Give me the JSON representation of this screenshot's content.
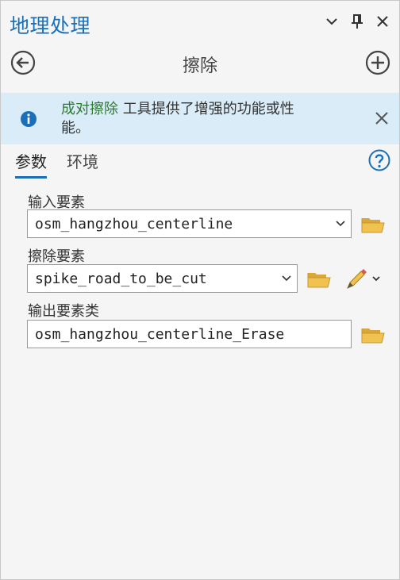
{
  "pane": {
    "title": "地理处理",
    "icons": {
      "dropdown": "chevron-down-icon",
      "pin": "pin-icon",
      "close": "close-icon"
    }
  },
  "nav": {
    "title": "擦除",
    "back_icon": "back-arrow-icon",
    "add_icon": "add-circle-icon"
  },
  "banner": {
    "link_text": "成对擦除",
    "message_line1": " 工具提供了增强的功能或性",
    "message_line2": "能。",
    "info_icon": "info-icon",
    "close_icon": "close-icon",
    "background": "#d9ecf8"
  },
  "tabs": [
    {
      "label": "参数",
      "active": true
    },
    {
      "label": "环境",
      "active": false
    }
  ],
  "help_icon": "help-icon",
  "parameters": [
    {
      "label": "输入要素",
      "value": "osm_hangzhou_centerline",
      "type": "dropdown"
    },
    {
      "label": "擦除要素",
      "value": "spike_road_to_be_cut",
      "type": "dropdown"
    },
    {
      "label": "输出要素类",
      "value": "osm_hangzhou_centerline_Erase",
      "type": "text"
    }
  ],
  "colors": {
    "accent": "#1a70b8",
    "link": "#2d7a2d",
    "folder": "#e8b84a"
  }
}
